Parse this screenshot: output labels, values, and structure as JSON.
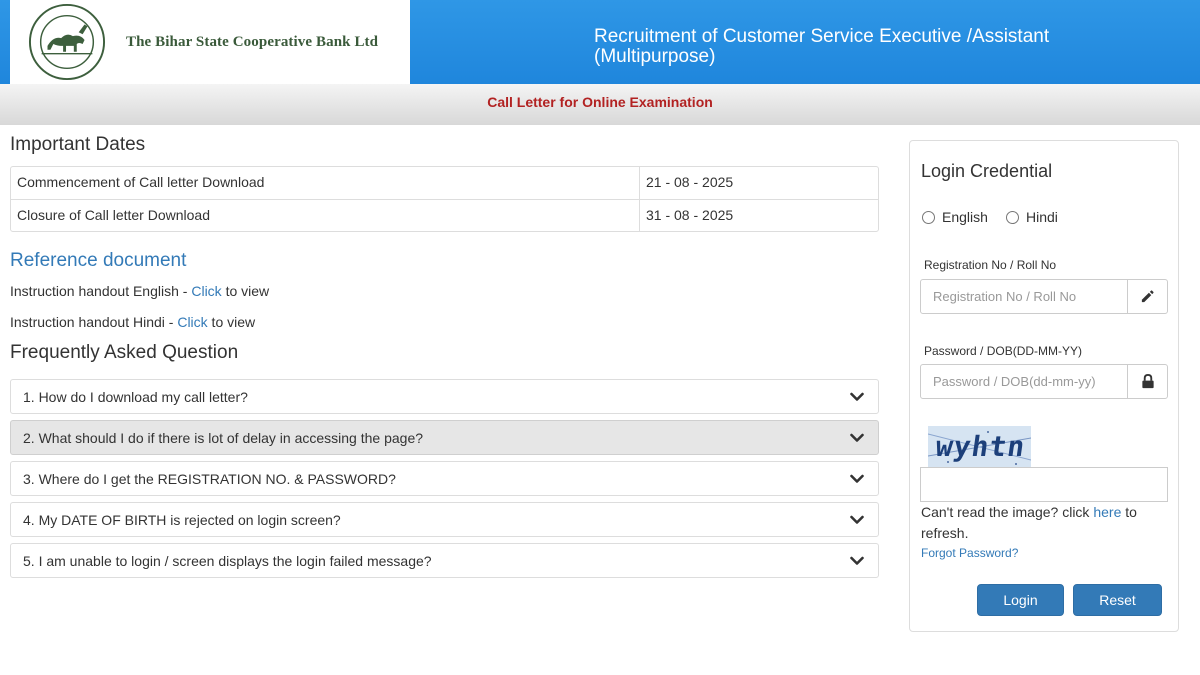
{
  "header": {
    "bank_name": "The Bihar State Cooperative Bank Ltd",
    "title_line1": "Recruitment of Customer Service Executive /Assistant",
    "title_line2": "(Multipurpose)",
    "colors": {
      "header_blue": "#2a91e2",
      "subheader_red": "#b22222",
      "link_blue": "#337ab7"
    }
  },
  "subheader": {
    "text": "Call Letter for Online Examination"
  },
  "important_dates": {
    "heading": "Important Dates",
    "rows": [
      {
        "label": "Commencement of Call letter Download",
        "value": "21 - 08 - 2025"
      },
      {
        "label": "Closure of Call letter Download",
        "value": "31 - 08 - 2025"
      }
    ]
  },
  "reference": {
    "heading": "Reference document",
    "items": [
      {
        "prefix": "Instruction handout English - ",
        "link": "Click",
        "suffix": " to view"
      },
      {
        "prefix": "Instruction handout Hindi - ",
        "link": "Click",
        "suffix": " to view"
      }
    ]
  },
  "faq": {
    "heading": "Frequently Asked Question",
    "items": [
      {
        "q": "1. How do I download my call letter?"
      },
      {
        "q": "2. What should I do if there is lot of delay in accessing the page?"
      },
      {
        "q": "3. Where do I get the REGISTRATION NO. & PASSWORD?"
      },
      {
        "q": "4. My DATE OF BIRTH is rejected on login screen?"
      },
      {
        "q": "5. I am unable to login / screen displays the login failed message?"
      }
    ],
    "icon": "chevron-down-icon"
  },
  "login": {
    "title": "Login Credential",
    "languages": [
      "English",
      "Hindi"
    ],
    "reg_label": "Registration No / Roll No",
    "reg_placeholder": "Registration No / Roll No",
    "pwd_label": "Password / DOB(DD-MM-YY)",
    "pwd_placeholder": "Password / DOB(dd-mm-yy)",
    "captcha_text": "wyhtn",
    "refresh_prefix": "Can't read the image? click ",
    "refresh_link": "here",
    "refresh_suffix": " to refresh.",
    "forgot": "Forgot Password?",
    "login_button": "Login",
    "reset_button": "Reset",
    "icons": {
      "reg": "pencil-icon",
      "pwd": "lock-icon"
    }
  }
}
